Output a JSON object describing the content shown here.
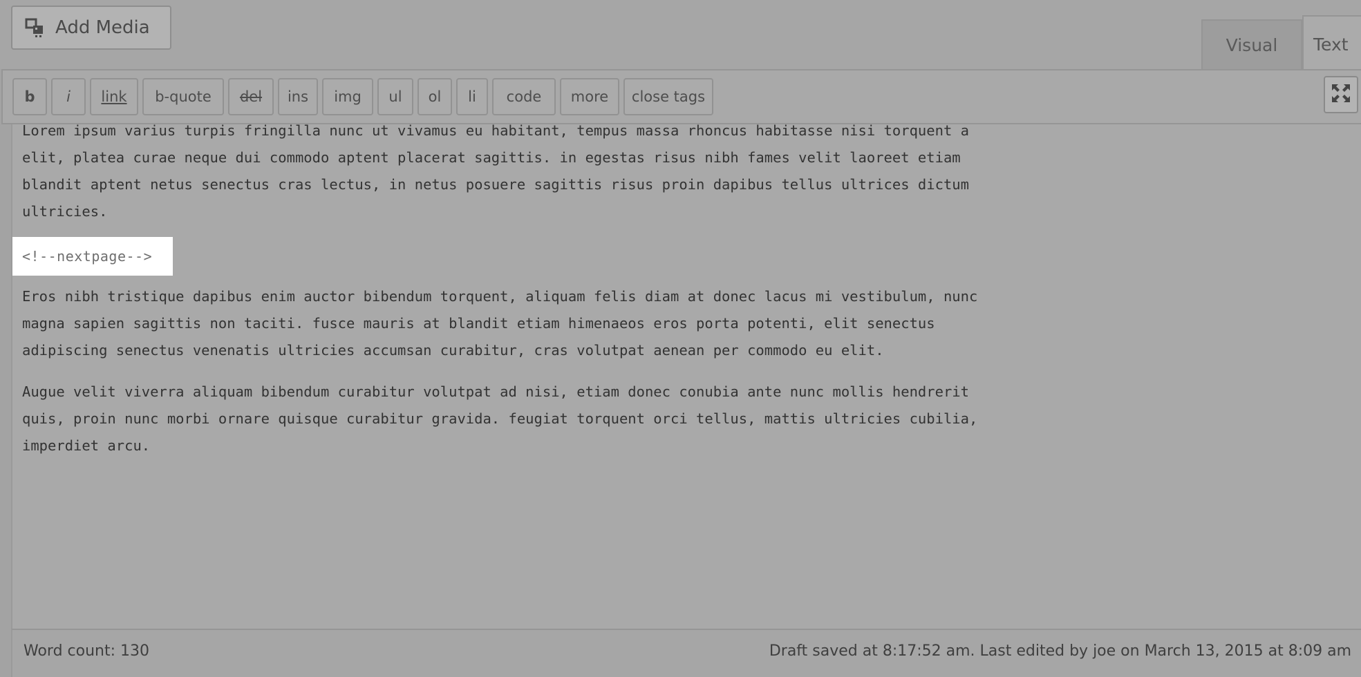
{
  "toolbar_top": {
    "add_media_label": "Add Media",
    "add_media_icon": "media-icon"
  },
  "tabs": {
    "visual": "Visual",
    "text": "Text",
    "active": "text"
  },
  "quicktags": {
    "b": "b",
    "i": "i",
    "link": "link",
    "bquote": "b-quote",
    "del": "del",
    "ins": "ins",
    "img": "img",
    "ul": "ul",
    "ol": "ol",
    "li": "li",
    "code": "code",
    "more": "more",
    "close_tags": "close tags",
    "fullscreen_icon": "fullscreen-icon"
  },
  "content": {
    "paragraph_1": "Lorem ipsum varius turpis fringilla nunc ut vivamus eu habitant, tempus massa rhoncus habitasse nisi torquent a\nelit, platea curae neque dui commodo aptent placerat sagittis. in egestas risus nibh fames velit laoreet etiam\nblandit aptent netus senectus cras lectus, in netus posuere sagittis risus proin dapibus tellus ultrices dictum\nultricies.",
    "nextpage_tag": "<!--nextpage-->",
    "paragraph_2": "Eros nibh tristique dapibus enim auctor bibendum torquent, aliquam felis diam at donec lacus mi vestibulum, nunc\nmagna sapien sagittis non taciti. fusce mauris at blandit etiam himenaeos eros porta potenti, elit senectus\nadipiscing senectus venenatis ultricies accumsan curabitur, cras volutpat aenean per commodo eu elit.",
    "paragraph_3": "Augue velit viverra aliquam bibendum curabitur volutpat ad nisi, etiam donec conubia ante nunc mollis hendrerit\nquis, proin nunc morbi ornare quisque curabitur gravida. feugiat torquent orci tellus, mattis ultricies cubilia,\nimperdiet arcu."
  },
  "status": {
    "word_count": "Word count: 130",
    "draft_status": "Draft saved at 8:17:52 am. Last edited by joe on March 13, 2015 at 8:09 am"
  },
  "colors": {
    "highlight": "#ffffff",
    "background": "#a9a9a9"
  }
}
